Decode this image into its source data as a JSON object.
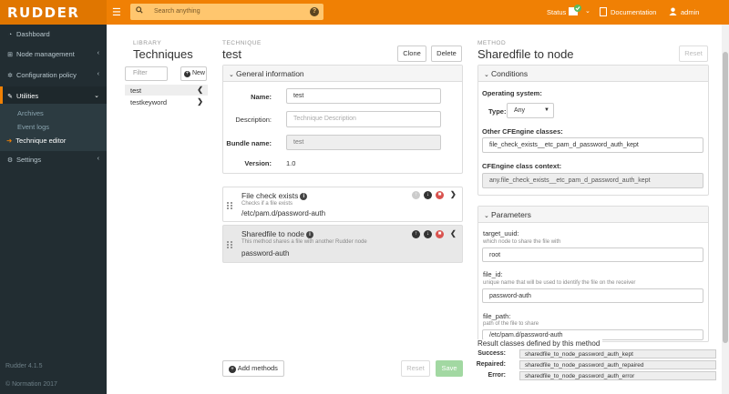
{
  "topbar": {
    "logo": "RUDDER",
    "search_placeholder": "Search anything",
    "status_label": "Status",
    "documentation_label": "Documentation",
    "user_label": "admin"
  },
  "sidebar": {
    "items": [
      {
        "label": "Dashboard",
        "icon": "tachometer-icon"
      },
      {
        "label": "Node management",
        "icon": "sitemap-icon"
      },
      {
        "label": "Configuration policy",
        "icon": "gears-icon"
      },
      {
        "label": "Utilities",
        "icon": "wrench-icon"
      },
      {
        "label": "Settings",
        "icon": "gear-icon"
      }
    ],
    "subitems": [
      {
        "label": "Archives"
      },
      {
        "label": "Event logs"
      },
      {
        "label": "Technique editor"
      }
    ],
    "version": "Rudder 4.1.5",
    "copyright": "© Normation 2017"
  },
  "library": {
    "small_title": "LIBRARY",
    "title": "Techniques",
    "filter_placeholder": "Filter",
    "new_label": "New",
    "items": [
      {
        "label": "test"
      },
      {
        "label": "testkeyword"
      }
    ]
  },
  "technique": {
    "small_title": "TECHNIQUE",
    "title": "test",
    "clone_label": "Clone",
    "delete_label": "Delete",
    "general_info_title": "General information",
    "name_label": "Name:",
    "name_value": "test",
    "description_label": "Description:",
    "description_placeholder": "Technique Description",
    "bundle_label": "Bundle name:",
    "bundle_value": "test",
    "version_label": "Version:",
    "version_value": "1.0",
    "methods": [
      {
        "title": "File check exists",
        "desc": "Checks if a file exists",
        "param": "/etc/pam.d/password-auth"
      },
      {
        "title": "Sharedfile to node",
        "desc": "This method shares a file with another Rudder node",
        "param": "password-auth"
      }
    ],
    "add_methods_label": "Add methods",
    "reset_label": "Reset",
    "save_label": "Save"
  },
  "method": {
    "small_title": "METHOD",
    "title": "Sharedfile to node",
    "reset_label": "Reset",
    "conditions_title": "Conditions",
    "os_label": "Operating system:",
    "type_label": "Type:",
    "type_value": "Any",
    "other_classes_label": "Other CFEngine classes:",
    "other_classes_value": "file_check_exists__etc_pam_d_password_auth_kept",
    "class_context_label": "CFEngine class context:",
    "class_context_value": "any.file_check_exists__etc_pam_d_password_auth_kept",
    "parameters_title": "Parameters",
    "params": [
      {
        "name": "target_uuid:",
        "desc": "which node to share the file with",
        "value": "root"
      },
      {
        "name": "file_id:",
        "desc": "unique name that will be used to identify the file on the receiver",
        "value": "password-auth"
      },
      {
        "name": "file_path:",
        "desc": "path of the file to share",
        "value": "/etc/pam.d/password-auth"
      }
    ],
    "result_title": "Result classes defined by this method",
    "results": [
      {
        "label": "Success:",
        "value": "sharedfile_to_node_password_auth_kept"
      },
      {
        "label": "Repaired:",
        "value": "sharedfile_to_node_password_auth_repaired"
      },
      {
        "label": "Error:",
        "value": "sharedfile_to_node_password_auth_error"
      }
    ]
  },
  "colors": {
    "brand": "#f08004",
    "sidebar": "#222d32",
    "save": "#a2d8a2",
    "status_ok": "#5cb85c",
    "delete_red": "#d9534f"
  }
}
